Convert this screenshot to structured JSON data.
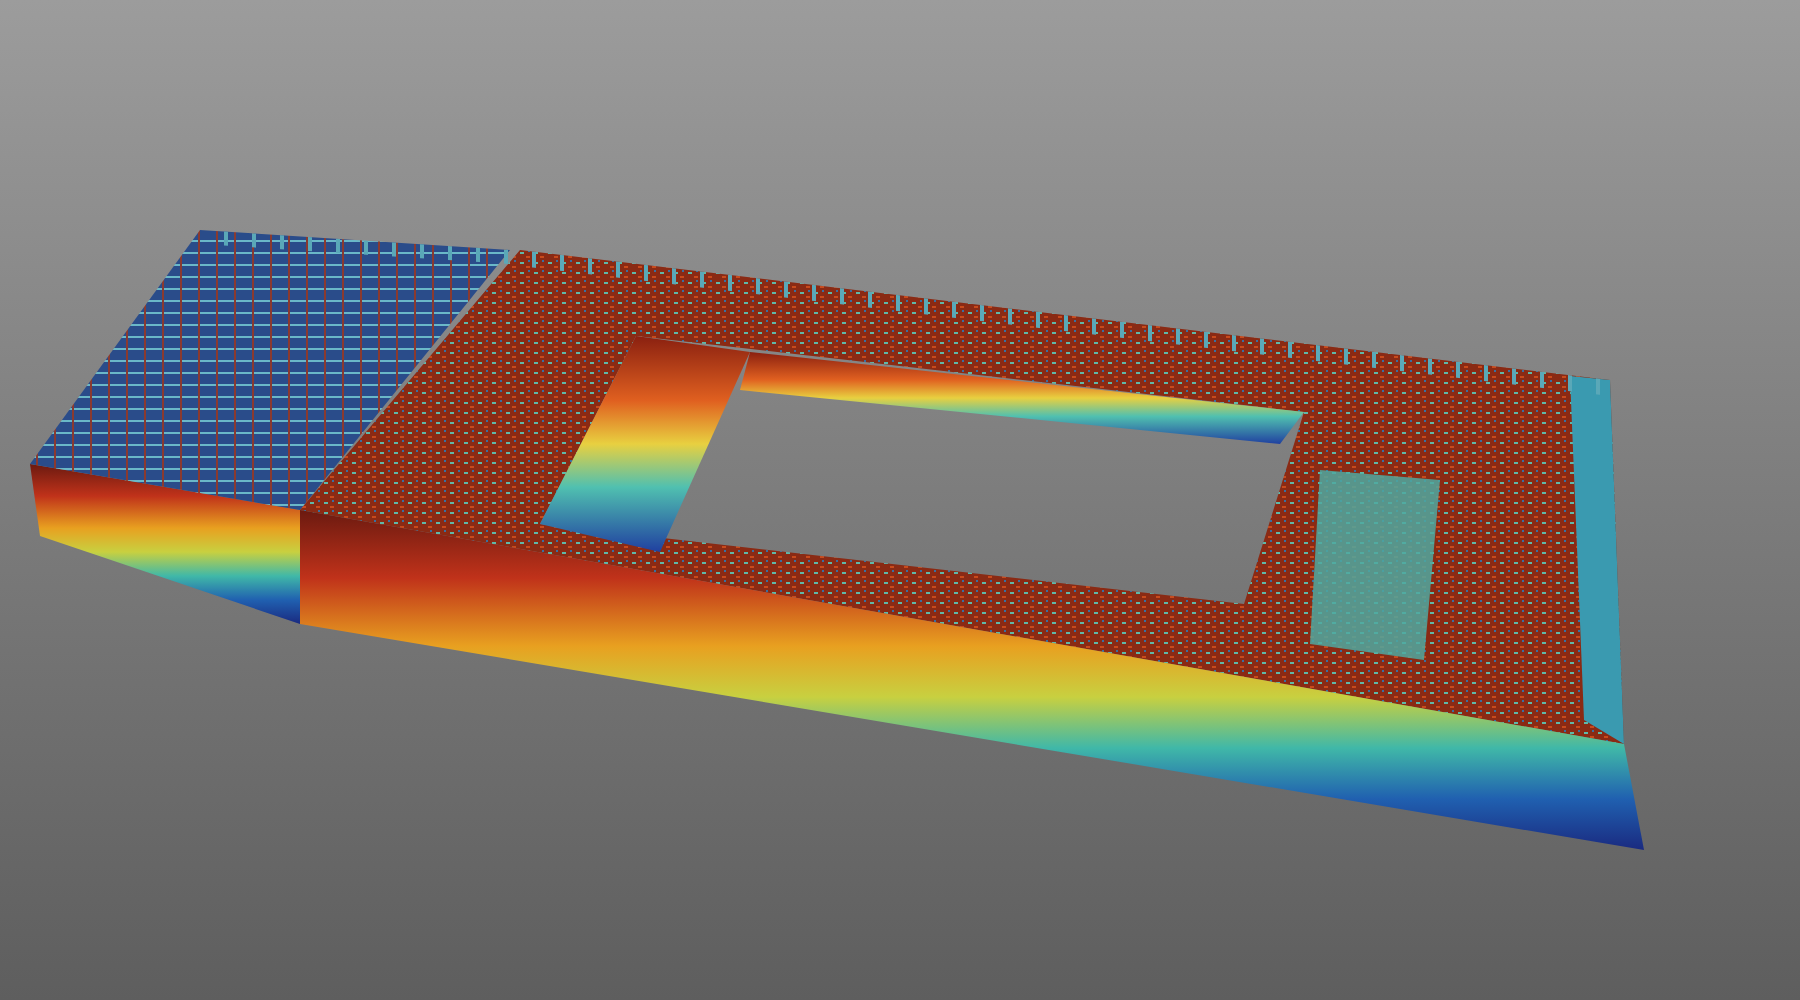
{
  "viewport": {
    "kind": "point_cloud"
  }
}
